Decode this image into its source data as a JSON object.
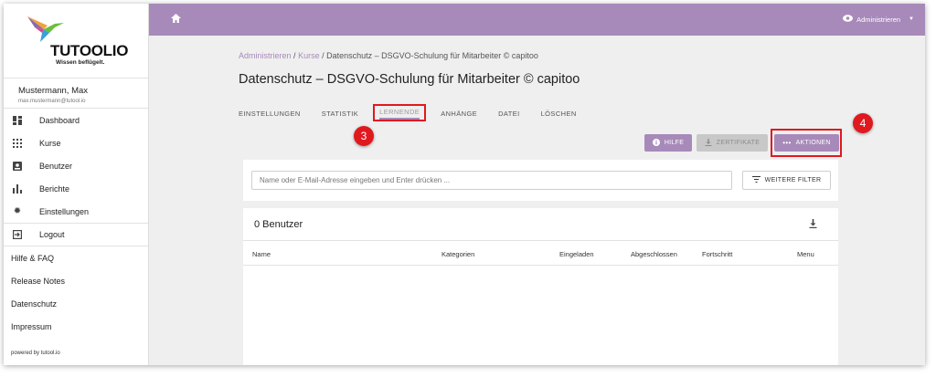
{
  "brand": {
    "name": "TUTOOLIO",
    "tagline": "Wissen beflügelt.",
    "accent": "#a78ab9",
    "highlight": "#e0191f"
  },
  "user": {
    "name": "Mustermann, Max",
    "email": "max.mustermann@tutool.io"
  },
  "nav": [
    {
      "label": "Dashboard",
      "icon": "dashboard-icon"
    },
    {
      "label": "Kurse",
      "icon": "grid-icon"
    },
    {
      "label": "Benutzer",
      "icon": "person-icon"
    },
    {
      "label": "Berichte",
      "icon": "bar-chart-icon"
    },
    {
      "label": "Einstellungen",
      "icon": "gear-icon"
    }
  ],
  "logout": {
    "label": "Logout",
    "icon": "logout-icon"
  },
  "links": [
    "Hilfe & FAQ",
    "Release Notes",
    "Datenschutz",
    "Impressum"
  ],
  "powered": "powered by tutool.io",
  "topbar": {
    "admin_label": "Administrieren"
  },
  "breadcrumb": {
    "item1": "Administrieren",
    "item2": "Kurse",
    "current": "Datenschutz – DSGVO-Schulung für Mitarbeiter © capitoo"
  },
  "page_title": "Datenschutz – DSGVO-Schulung für Mitarbeiter © capitoo",
  "tabs": [
    "EINSTELLUNGEN",
    "STATISTIK",
    "LERNENDE",
    "ANHÄNGE",
    "DATEI",
    "LÖSCHEN"
  ],
  "badges": {
    "three": "3",
    "four": "4"
  },
  "actions": {
    "hilfe": "HILFE",
    "zertifikate": "ZERTIFIKATE",
    "aktionen": "AKTIONEN"
  },
  "search": {
    "placeholder": "Name oder E-Mail-Adresse eingeben und Enter drücken ..."
  },
  "filter": {
    "label": "WEITERE FILTER"
  },
  "table": {
    "count": "0 Benutzer",
    "columns": [
      "Name",
      "Kategorien",
      "Eingeladen",
      "Abgeschlossen",
      "Fortschritt",
      "Menu"
    ]
  }
}
